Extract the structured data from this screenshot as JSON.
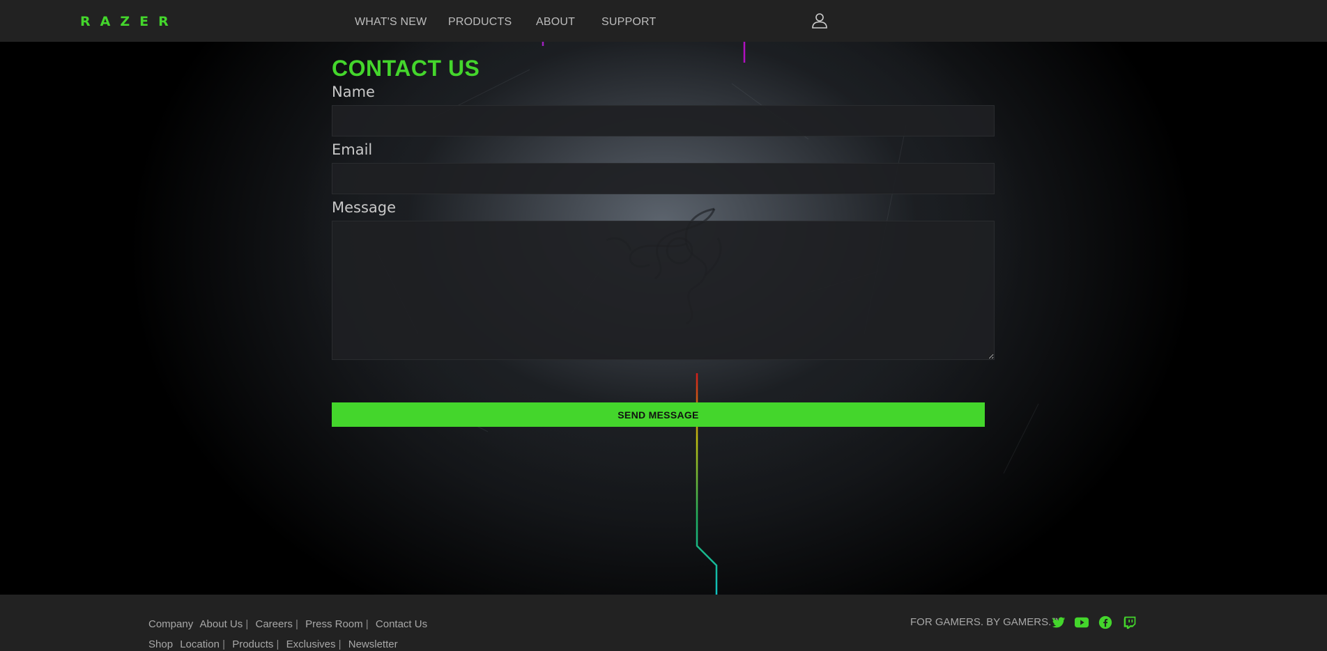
{
  "nav": {
    "logo": "RAZER",
    "links": [
      "WHAT'S NEW",
      "PRODUCTS",
      "ABOUT",
      "SUPPORT"
    ],
    "user_icon": "user-icon"
  },
  "contact": {
    "title": "CONTACT US",
    "name_label": "Name",
    "name_value": "",
    "email_label": "Email",
    "email_value": "",
    "message_label": "Message",
    "message_value": "",
    "submit_label": "SEND MESSAGE"
  },
  "footer": {
    "row1": [
      "Company",
      "About Us",
      "Careers",
      "Press Room",
      "Contact Us"
    ],
    "row2": [
      "Shop",
      "Location",
      "Products",
      "Exclusives",
      "Newsletter"
    ],
    "tagline": "FOR GAMERS. BY GAMERS.™",
    "social": [
      "twitter-icon",
      "youtube-icon",
      "facebook-icon",
      "twitch-icon"
    ]
  },
  "colors": {
    "accent": "#44d62c",
    "nav_bg": "#222222",
    "footer_bg": "#222222"
  }
}
